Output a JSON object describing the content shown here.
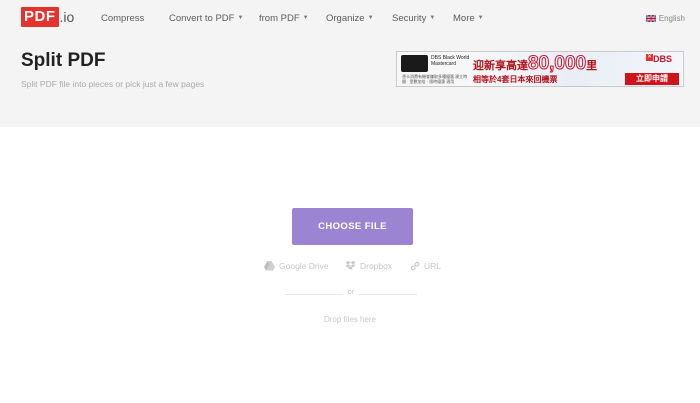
{
  "logo": {
    "brand": "PDF",
    "suffix": ".io"
  },
  "nav": [
    {
      "label": "Compress",
      "dropdown": false
    },
    {
      "label": "Convert to PDF",
      "dropdown": true
    },
    {
      "label": "from PDF",
      "dropdown": true
    },
    {
      "label": "Organize",
      "dropdown": true
    },
    {
      "label": "Security",
      "dropdown": true
    },
    {
      "label": "More",
      "dropdown": true
    }
  ],
  "language": {
    "label": "English",
    "icon": "uk-flag-icon"
  },
  "page": {
    "title": "Split PDF",
    "subtitle": "Split PDF file into pieces or pick just a few pages"
  },
  "ad": {
    "card_text": "DBS Black World Mastercard",
    "small_text": "憑卡消費有機會賺取多種優惠 建立時間 · 里數加倍 · 限時優惠 適用",
    "headline_prefix": "迎新享高達",
    "headline_number": "80,000",
    "headline_suffix": "里",
    "subline": "相等於4套日本來回機票",
    "cta": "立即申請",
    "brand": "DBS",
    "close": "✕"
  },
  "upload": {
    "choose_label": "CHOOSE FILE",
    "sources": [
      {
        "label": "Google Drive",
        "icon": "google-drive-icon"
      },
      {
        "label": "Dropbox",
        "icon": "dropbox-icon"
      },
      {
        "label": "URL",
        "icon": "link-icon"
      }
    ],
    "or_label": "or",
    "drop_label": "Drop files here"
  },
  "colors": {
    "brand_red": "#e5322d",
    "button_purple": "#9b85d2",
    "header_bg": "#f4f4f4"
  }
}
